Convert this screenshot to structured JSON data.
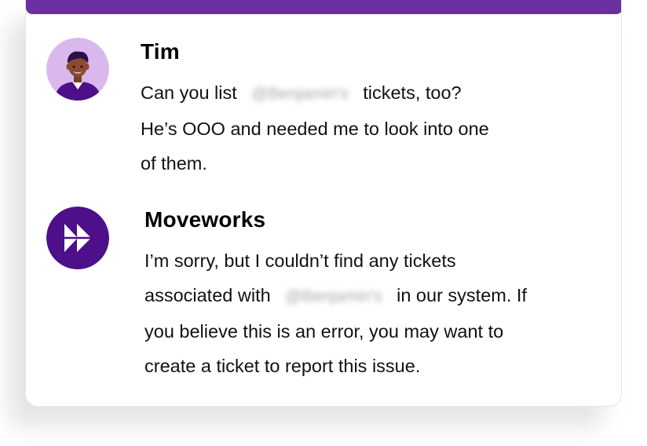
{
  "colors": {
    "brand_purple": "#6b2fa3",
    "tim_avatar_bg": "#d9b8ee",
    "moveworks_avatar_bg": "#4d0f8a"
  },
  "messages": [
    {
      "sender": "Tim",
      "avatar_icon": "user-avatar-icon",
      "lines": {
        "l1_pre": "Can you list",
        "l1_mention": "@Benjamin's",
        "l1_post": "tickets, too?",
        "l2": "He’s OOO and needed me to look into one",
        "l3": "of them."
      }
    },
    {
      "sender": "Moveworks",
      "avatar_icon": "moveworks-logo-icon",
      "lines": {
        "l1": "I’m sorry, but I couldn’t find any tickets",
        "l2_pre": "associated with",
        "l2_mention": "@Benjamin's",
        "l2_post": "in our system. If",
        "l3": "you believe this is an error, you may want to",
        "l4": "create a ticket to report this issue."
      }
    }
  ]
}
